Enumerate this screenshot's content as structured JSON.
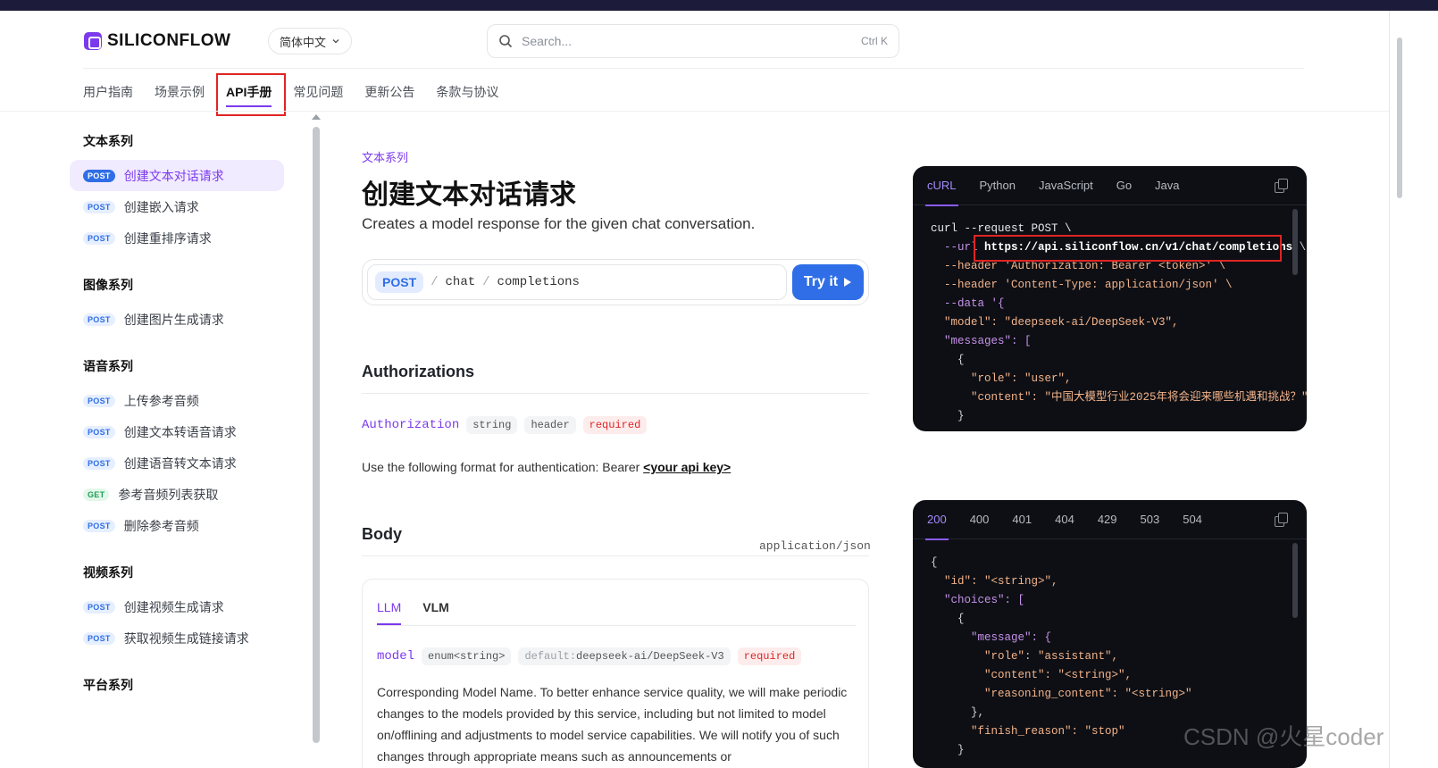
{
  "header": {
    "logo_text": "SILICONFLOW",
    "language": "简体中文",
    "search_placeholder": "Search...",
    "search_shortcut": "Ctrl K"
  },
  "topnav": {
    "tabs": [
      {
        "label": "用户指南"
      },
      {
        "label": "场景示例"
      },
      {
        "label": "API手册",
        "active": true
      },
      {
        "label": "常见问题"
      },
      {
        "label": "更新公告"
      },
      {
        "label": "条款与协议"
      }
    ]
  },
  "sidebar": {
    "groups": [
      {
        "title": "文本系列",
        "items": [
          {
            "method": "POST",
            "label": "创建文本对话请求",
            "active": true
          },
          {
            "method": "POST",
            "label": "创建嵌入请求"
          },
          {
            "method": "POST",
            "label": "创建重排序请求"
          }
        ]
      },
      {
        "title": "图像系列",
        "items": [
          {
            "method": "POST",
            "label": "创建图片生成请求"
          }
        ]
      },
      {
        "title": "语音系列",
        "items": [
          {
            "method": "POST",
            "label": "上传参考音频"
          },
          {
            "method": "POST",
            "label": "创建文本转语音请求"
          },
          {
            "method": "POST",
            "label": "创建语音转文本请求"
          },
          {
            "method": "GET",
            "label": "参考音频列表获取"
          },
          {
            "method": "POST",
            "label": "删除参考音频"
          }
        ]
      },
      {
        "title": "视频系列",
        "items": [
          {
            "method": "POST",
            "label": "创建视频生成请求"
          },
          {
            "method": "POST",
            "label": "获取视频生成链接请求"
          }
        ]
      },
      {
        "title": "平台系列",
        "items": []
      }
    ]
  },
  "main": {
    "breadcrumb": "文本系列",
    "title": "创建文本对话请求",
    "description": "Creates a model response for the given chat conversation.",
    "endpoint": {
      "method": "POST",
      "path_1": "chat",
      "path_2": "completions",
      "try_label": "Try it"
    },
    "authorizations": {
      "heading": "Authorizations",
      "param_name": "Authorization",
      "type": "string",
      "location": "header",
      "required": "required",
      "desc_prefix": "Use the following format for authentication: Bearer ",
      "desc_key": "<your api key>"
    },
    "body": {
      "heading": "Body",
      "content_type": "application/json",
      "tabs": [
        {
          "label": "LLM",
          "active": true
        },
        {
          "label": "VLM"
        }
      ],
      "model_param": "model",
      "model_type": "enum<string>",
      "model_default_label": "default:",
      "model_default": "deepseek-ai/DeepSeek-V3",
      "model_required": "required",
      "model_desc": "Corresponding Model Name. To better enhance service quality, we will make periodic changes to the models provided by this service, including but not limited to model on/offlining and adjustments to model service capabilities. We will notify you of such changes through appropriate means such as announcements or"
    }
  },
  "request_panel": {
    "tabs": [
      "cURL",
      "Python",
      "JavaScript",
      "Go",
      "Java"
    ],
    "active_tab": "cURL",
    "lines": [
      "curl --request POST \\",
      "  --url https://api.siliconflow.cn/v1/chat/completions \\",
      "  --header 'Authorization: Bearer <token>' \\",
      "  --header 'Content-Type: application/json' \\",
      "  --data '{",
      "  \"model\": \"deepseek-ai/DeepSeek-V3\",",
      "  \"messages\": [",
      "    {",
      "      \"role\": \"user\",",
      "      \"content\": \"中国大模型行业2025年将会迎来哪些机遇和挑战？\"",
      "    }"
    ]
  },
  "response_panel": {
    "tabs": [
      "200",
      "400",
      "401",
      "404",
      "429",
      "503",
      "504"
    ],
    "active_tab": "200",
    "lines": [
      "{",
      "  \"id\": \"<string>\",",
      "  \"choices\": [",
      "    {",
      "      \"message\": {",
      "        \"role\": \"assistant\",",
      "        \"content\": \"<string>\",",
      "        \"reasoning_content\": \"<string>\"",
      "      },",
      "      \"finish_reason\": \"stop\"",
      "    }"
    ]
  },
  "watermark": "CSDN @火星coder",
  "colors": {
    "accent": "#7c3aed",
    "primary_button": "#2f6ee6",
    "highlight_box": "#e02424"
  }
}
